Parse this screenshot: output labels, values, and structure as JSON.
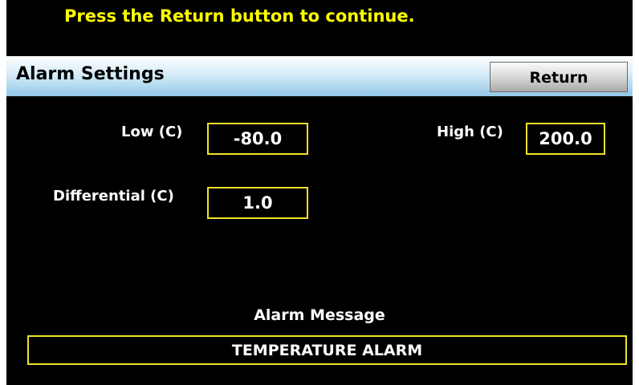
{
  "prompt": "Press the Return button to continue.",
  "header": {
    "title": "Alarm Settings",
    "return_label": "Return"
  },
  "fields": {
    "low": {
      "label": "Low (C)",
      "value": "-80.0"
    },
    "high": {
      "label": "High (C)",
      "value": "200.0"
    },
    "differential": {
      "label": "Differential (C)",
      "value": "1.0"
    }
  },
  "alarm_message": {
    "label": "Alarm Message",
    "value": "TEMPERATURE ALARM"
  },
  "colors": {
    "background": "#000000",
    "prompt_text": "#ffff00",
    "field_border": "#f0e12a",
    "title_bar_top": "#ffffff",
    "title_bar_bottom": "#93c8e8",
    "text": "#ffffff"
  }
}
